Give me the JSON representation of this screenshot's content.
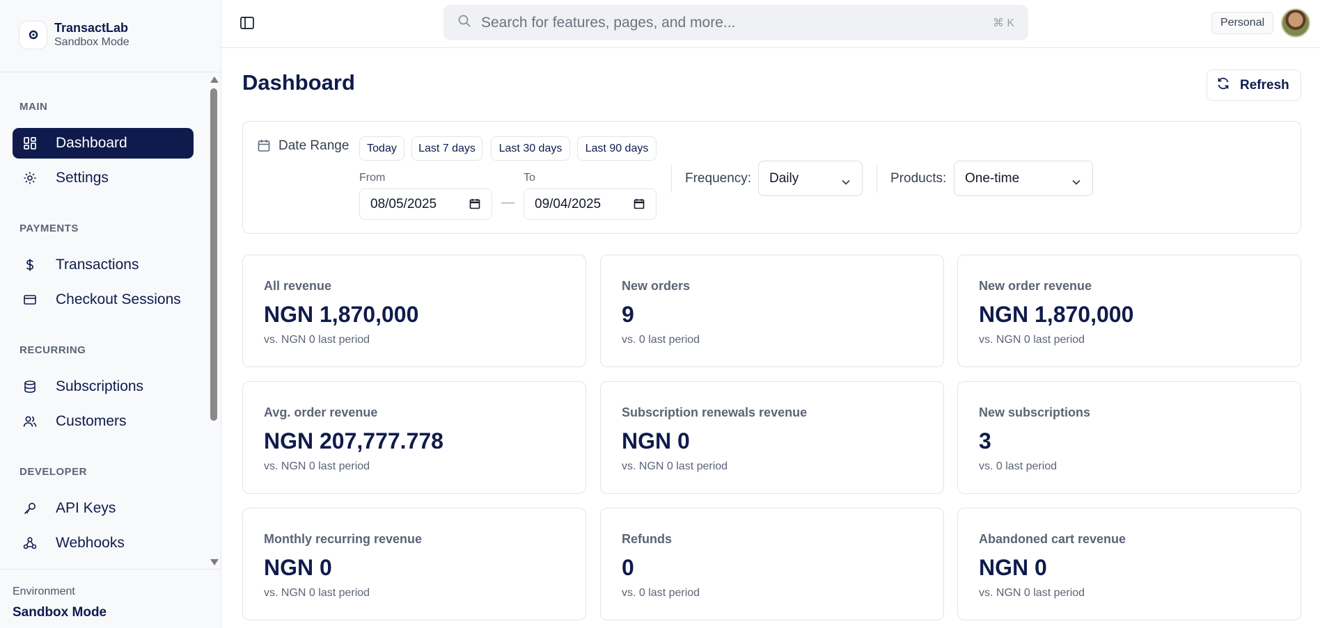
{
  "brand": {
    "name": "TransactLab",
    "subtitle": "Sandbox Mode"
  },
  "sidebar": {
    "sections": [
      "MAIN",
      "PAYMENTS",
      "RECURRING",
      "DEVELOPER"
    ],
    "items": [
      {
        "label": "Dashboard",
        "icon": "grid-icon",
        "active": true
      },
      {
        "label": "Settings",
        "icon": "gear-icon"
      },
      {
        "label": "Transactions",
        "icon": "dollar-icon"
      },
      {
        "label": "Checkout Sessions",
        "icon": "card-icon"
      },
      {
        "label": "Subscriptions",
        "icon": "database-icon"
      },
      {
        "label": "Customers",
        "icon": "users-icon"
      },
      {
        "label": "API Keys",
        "icon": "key-icon"
      },
      {
        "label": "Webhooks",
        "icon": "webhook-icon"
      }
    ],
    "environment": {
      "label": "Environment",
      "value": "Sandbox Mode"
    }
  },
  "topbar": {
    "search_placeholder": "Search for features, pages, and more...",
    "search_shortcut": "⌘ K",
    "account_badge": "Personal"
  },
  "main": {
    "title": "Dashboard",
    "refresh_label": "Refresh",
    "filters": {
      "date_range_label": "Date Range",
      "presets": [
        "Today",
        "Last 7 days",
        "Last 30 days",
        "Last 90 days"
      ],
      "from_label": "From",
      "from_value": "08/05/2025",
      "to_label": "To",
      "to_value": "09/04/2025",
      "separator": "—",
      "frequency_label": "Frequency:",
      "frequency_value": "Daily",
      "products_label": "Products:",
      "products_value": "One-time"
    },
    "metrics": [
      {
        "title": "All revenue",
        "value": "NGN 1,870,000",
        "sub": "vs. NGN 0 last period"
      },
      {
        "title": "New orders",
        "value": "9",
        "sub": "vs. 0 last period"
      },
      {
        "title": "New order revenue",
        "value": "NGN 1,870,000",
        "sub": "vs. NGN 0 last period"
      },
      {
        "title": "Avg. order revenue",
        "value": "NGN 207,777.778",
        "sub": "vs. NGN 0 last period"
      },
      {
        "title": "Subscription renewals revenue",
        "value": "NGN 0",
        "sub": "vs. NGN 0 last period"
      },
      {
        "title": "New subscriptions",
        "value": "3",
        "sub": "vs. 0 last period"
      },
      {
        "title": "Monthly recurring revenue",
        "value": "NGN 0",
        "sub": "vs. NGN 0 last period"
      },
      {
        "title": "Refunds",
        "value": "0",
        "sub": "vs. 0 last period"
      },
      {
        "title": "Abandoned cart revenue",
        "value": "NGN 0",
        "sub": "vs. NGN 0 last period"
      }
    ]
  },
  "colors": {
    "primary": "#0f1b4c",
    "muted": "#5b6476",
    "border": "#e2e4e8"
  }
}
